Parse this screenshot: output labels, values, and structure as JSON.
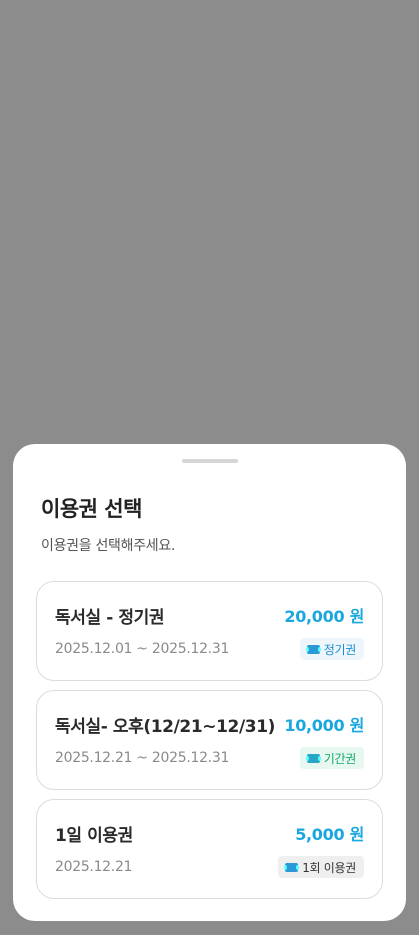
{
  "sheet": {
    "title": "이용권 선택",
    "subtitle": "이용권을 선택해주세요."
  },
  "passes": [
    {
      "name": "독서실 - 정기권",
      "price": "20,000 원",
      "date": "2025.12.01 ~ 2025.12.31",
      "badge": "정기권",
      "badge_color": "#1a8fcf",
      "badge_icon": "ticket-icon"
    },
    {
      "name": "독서실- 오후(12/21~12/31)",
      "price": "10,000 원",
      "date": "2025.12.21 ~ 2025.12.31",
      "badge": "기간권",
      "badge_color": "#14a86a",
      "badge_icon": "ticket-icon"
    },
    {
      "name": "1일 이용권",
      "price": "5,000 원",
      "date": "2025.12.21",
      "badge": "1회 이용권",
      "badge_color": "#333333",
      "badge_icon": "ticket-icon"
    }
  ],
  "colors": {
    "overlay": "#8c8c8c",
    "price": "#1aa7e0"
  }
}
